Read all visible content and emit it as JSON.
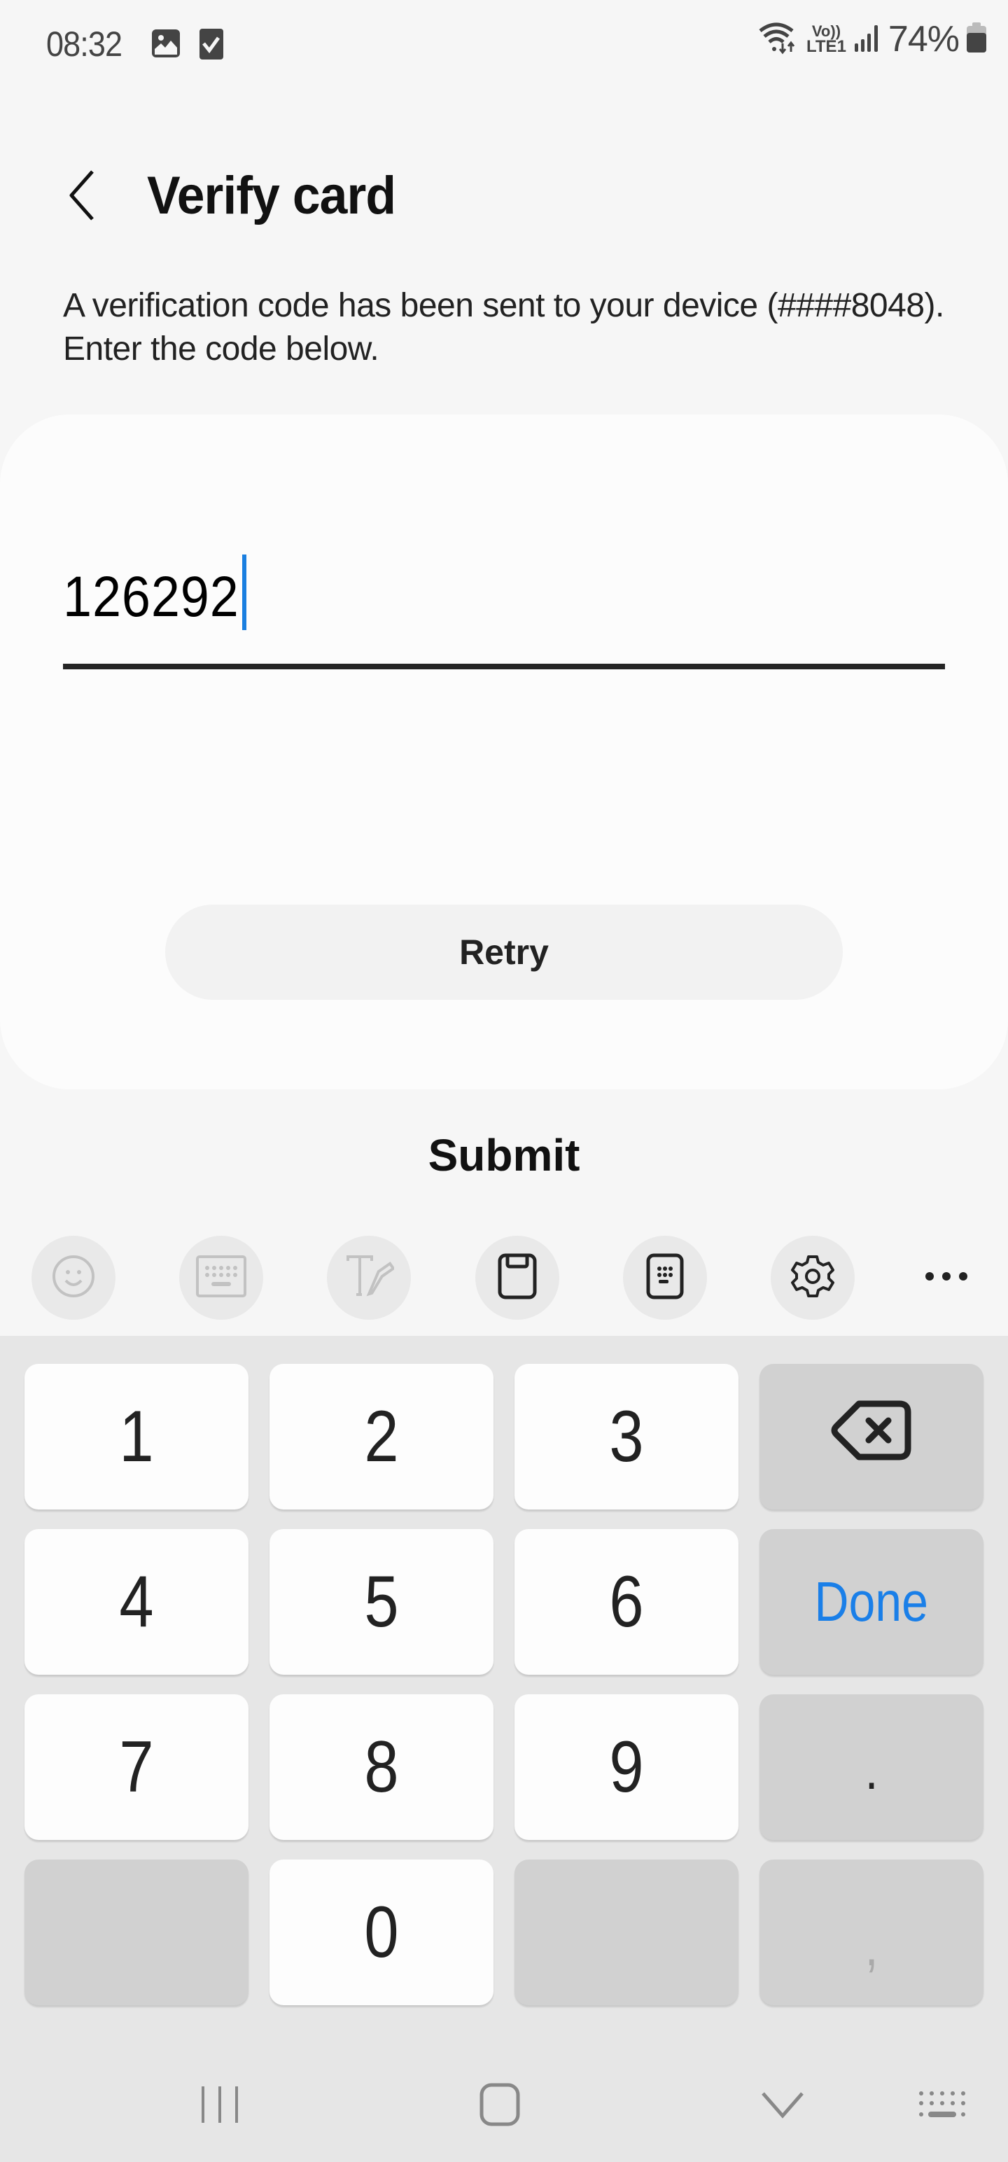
{
  "status_bar": {
    "time": "08:32",
    "left_icons": [
      "gallery-icon",
      "task-check-icon"
    ],
    "right_icons": [
      "wifi-icon",
      "volte-lte1-icon",
      "cellular-signal-icon",
      "battery-icon"
    ],
    "volte_label": "Vo))",
    "lte_label": "LTE1",
    "battery_percent": "74%"
  },
  "header": {
    "back_icon": "chevron-left-icon",
    "title": "Verify card"
  },
  "description": "A verification code has been sent to your device (####8048). Enter the code below.",
  "code_input": {
    "value": "126292",
    "focused": true
  },
  "buttons": {
    "retry": "Retry",
    "submit": "Submit"
  },
  "keyboard_toolbar": [
    {
      "icon": "emoji-icon",
      "enabled": false
    },
    {
      "icon": "keyboard-icon",
      "enabled": false
    },
    {
      "icon": "handwriting-icon",
      "enabled": false
    },
    {
      "icon": "clipboard-icon",
      "enabled": true
    },
    {
      "icon": "keypad-mode-icon",
      "enabled": true
    },
    {
      "icon": "settings-gear-icon",
      "enabled": true
    },
    {
      "icon": "more-dots-icon",
      "enabled": true
    }
  ],
  "keyboard": {
    "rows": [
      [
        "1",
        "2",
        "3",
        "backspace"
      ],
      [
        "4",
        "5",
        "6",
        "Done"
      ],
      [
        "7",
        "8",
        "9",
        "."
      ],
      [
        "",
        "0",
        "",
        ","
      ]
    ],
    "done_label": "Done",
    "accent_color": "#1a7fe8"
  },
  "nav_bar": [
    "recent-apps-icon",
    "home-icon",
    "hide-keyboard-icon",
    "keyboard-switch-icon"
  ]
}
